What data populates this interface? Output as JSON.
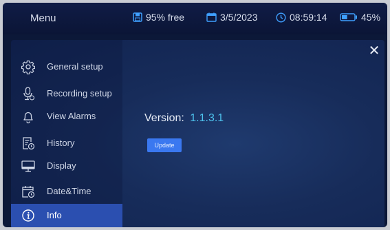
{
  "header": {
    "title": "Menu",
    "storage": {
      "icon": "save-icon",
      "text": "95% free"
    },
    "date": {
      "icon": "calendar-icon",
      "text": "3/5/2023"
    },
    "time": {
      "icon": "clock-icon",
      "text": "08:59:14"
    },
    "battery": {
      "icon": "battery-icon",
      "text": "45%",
      "level": 0.45
    }
  },
  "sidebar": {
    "items": [
      {
        "label": "General setup",
        "icon": "gear-icon"
      },
      {
        "label": "Recording setup",
        "icon": "microphone-icon"
      },
      {
        "label": "View Alarms",
        "icon": "bell-icon"
      },
      {
        "label": "History",
        "icon": "history-icon"
      },
      {
        "label": "Display",
        "icon": "monitor-icon"
      },
      {
        "label": "Date&Time",
        "icon": "calendar-clock-icon"
      },
      {
        "label": "Info",
        "icon": "info-icon",
        "active": true
      }
    ]
  },
  "info": {
    "version_label": "Version:",
    "version_value": "1.1.3.1",
    "update_label": "Update"
  },
  "close": {
    "icon": "close-icon",
    "glyph": "✕"
  },
  "colors": {
    "accent": "#2b4fb0",
    "button": "#3a78f0",
    "version_text": "#4ec3ee",
    "status_icons": "#3fa0ff"
  }
}
